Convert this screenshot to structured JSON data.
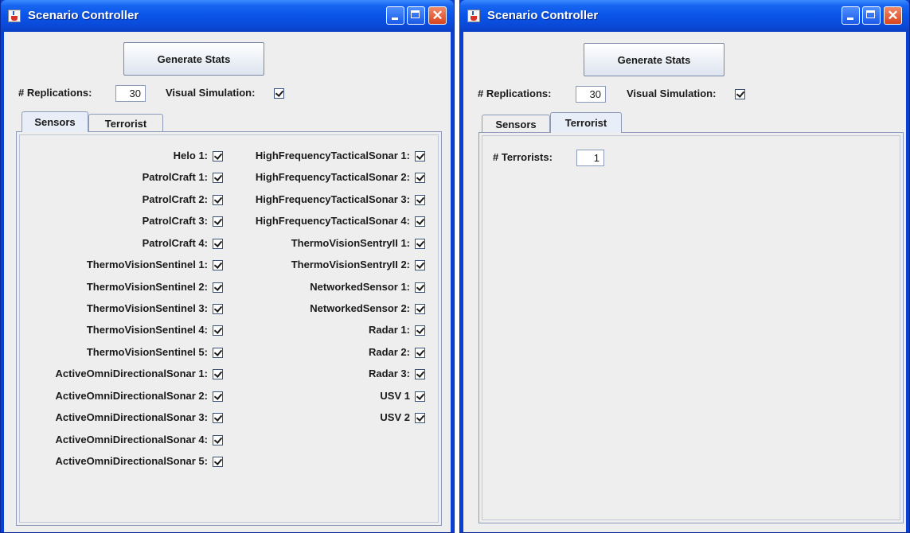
{
  "left_window": {
    "title": "Scenario Controller",
    "generate_label": "Generate Stats",
    "replications_label": "# Replications:",
    "replications_value": "30",
    "visual_label": "Visual Simulation:",
    "visual_checked": true,
    "tabs": [
      "Sensors",
      "Terrorist"
    ],
    "selected_tab": "Sensors",
    "sensors_left": [
      "Helo 1:",
      "PatrolCraft 1:",
      "PatrolCraft 2:",
      "PatrolCraft 3:",
      "PatrolCraft 4:",
      "ThermoVisionSentinel 1:",
      "ThermoVisionSentinel 2:",
      "ThermoVisionSentinel 3:",
      "ThermoVisionSentinel 4:",
      "ThermoVisionSentinel 5:",
      "ActiveOmniDirectionalSonar 1:",
      "ActiveOmniDirectionalSonar 2:",
      "ActiveOmniDirectionalSonar 3:",
      "ActiveOmniDirectionalSonar 4:",
      "ActiveOmniDirectionalSonar 5:"
    ],
    "sensors_right": [
      "HighFrequencyTacticalSonar 1:",
      "HighFrequencyTacticalSonar 2:",
      "HighFrequencyTacticalSonar 3:",
      "HighFrequencyTacticalSonar 4:",
      "ThermoVisionSentryII 1:",
      "ThermoVisionSentryII 2:",
      "NetworkedSensor 1:",
      "NetworkedSensor 2:",
      "Radar 1:",
      "Radar 2:",
      "Radar 3:",
      "USV 1",
      "USV 2"
    ]
  },
  "right_window": {
    "title": "Scenario Controller",
    "generate_label": "Generate Stats",
    "replications_label": "# Replications:",
    "replications_value": "30",
    "visual_label": "Visual Simulation:",
    "visual_checked": true,
    "tabs": [
      "Sensors",
      "Terrorist"
    ],
    "selected_tab": "Terrorist",
    "terrorists_label": "# Terrorists:",
    "terrorists_value": "1"
  },
  "icons": {
    "app": "java-cup-icon",
    "minimize": "minimize-icon",
    "maximize": "maximize-icon",
    "close": "close-icon"
  },
  "colors": {
    "titlebar": "#0a54e8",
    "client_bg": "#eeeeee",
    "close_button": "#d9441d"
  }
}
